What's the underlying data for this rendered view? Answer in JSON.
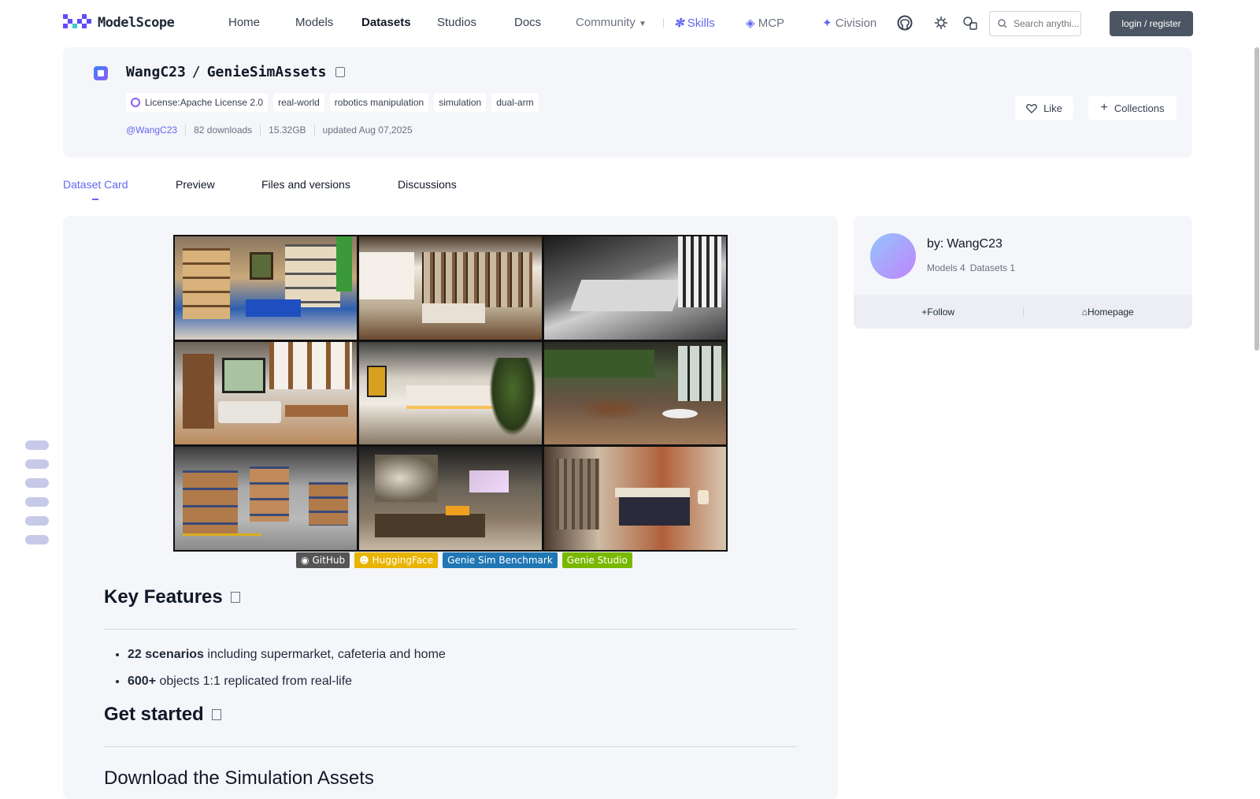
{
  "header": {
    "logo_text": "ModelScope",
    "nav": [
      "Home",
      "Models",
      "Datasets",
      "Studios",
      "Docs"
    ],
    "community": "Community",
    "skills": "Skills",
    "mcp": "MCP",
    "civision": "Civision",
    "search_placeholder": "Search anythi...",
    "login": "login / register",
    "colors": {
      "accent": "#6366f1",
      "logo": "#624aff"
    }
  },
  "dataset": {
    "owner": "WangC23",
    "slash": "/",
    "name": "GenieSimAssets",
    "license": "License:Apache License 2.0",
    "tags": [
      "real-world",
      "robotics manipulation",
      "simulation",
      "dual-arm"
    ],
    "author_handle": "@WangC23",
    "downloads": "82 downloads",
    "size": "15.32GB",
    "updated": "updated Aug 07,2025",
    "like": "Like",
    "collections": "Collections"
  },
  "tabs": [
    "Dataset Card",
    "Preview",
    "Files and versions",
    "Discussions"
  ],
  "content": {
    "badges": [
      {
        "label": "GitHub",
        "color": "#555555"
      },
      {
        "label": "HuggingFace",
        "color": "#e8b400"
      },
      {
        "label": "Genie Sim Benchmark",
        "color": "#1f77b4"
      },
      {
        "label": "Genie Studio",
        "color": "#7ab800"
      }
    ],
    "key_features_title": "Key Features",
    "features": [
      {
        "bold": "22 scenarios",
        "rest": " including supermarket, cafeteria and home"
      },
      {
        "bold": "600+",
        "rest": " objects 1:1 replicated from real-life"
      }
    ],
    "get_started_title": "Get started",
    "download_title": "Download the Simulation Assets"
  },
  "author": {
    "by_label": "by:",
    "name": "WangC23",
    "models": "Models 4",
    "datasets": "Datasets 1",
    "follow": "Follow",
    "homepage": "Homepage"
  }
}
